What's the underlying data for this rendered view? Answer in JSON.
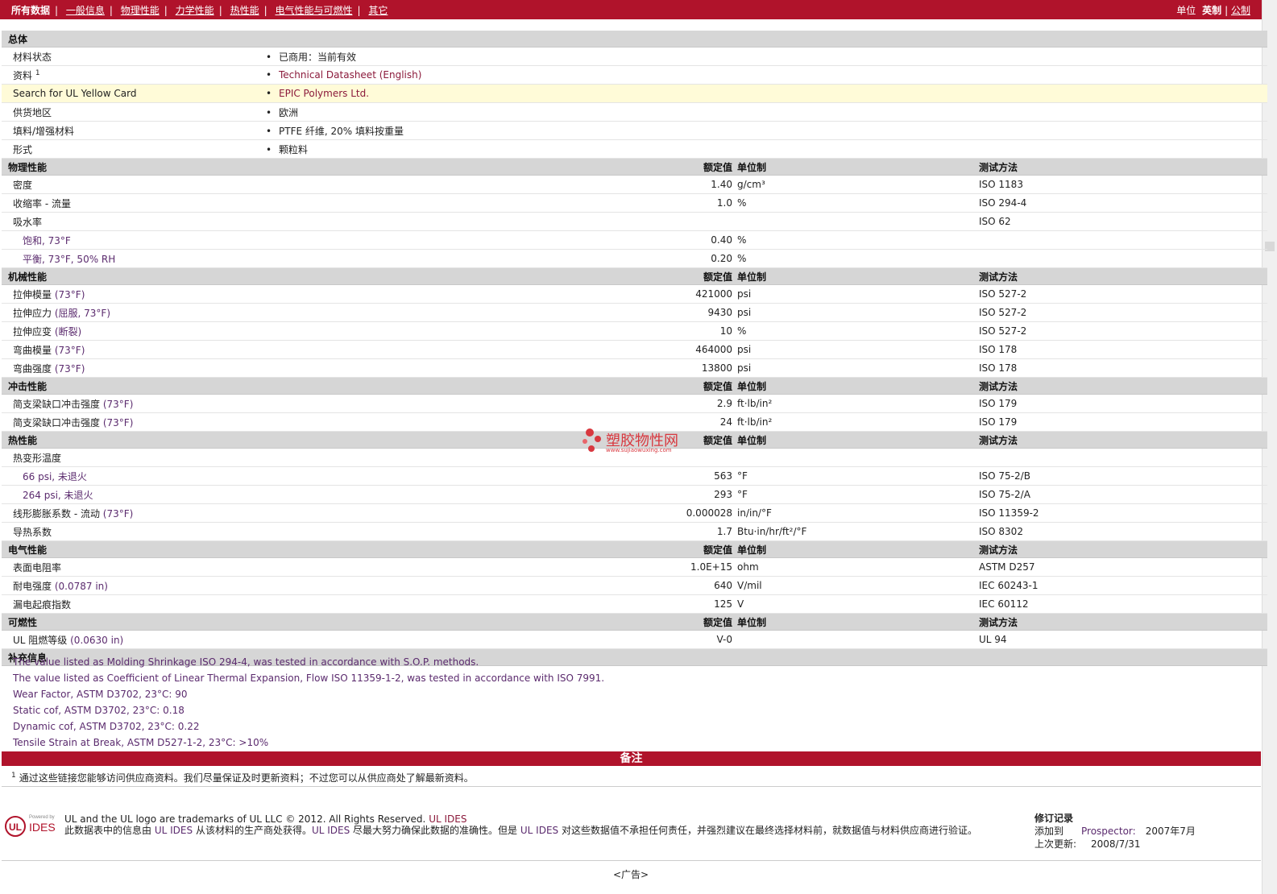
{
  "nav": {
    "all": "所有数据",
    "items": [
      "一般信息",
      "物理性能",
      "力学性能",
      "热性能",
      "电气性能与可燃性",
      "其它"
    ],
    "units_label": "单位",
    "units_active": "英制",
    "units_metric": "公制"
  },
  "general": {
    "title": "总体",
    "rows": [
      {
        "label": "材料状态",
        "value": "已商用：当前有效"
      },
      {
        "label": "资料",
        "sup": "1",
        "value": "Technical Datasheet (English)"
      },
      {
        "label": "Search for UL Yellow Card",
        "value": "EPIC Polymers Ltd."
      },
      {
        "label": "供货地区",
        "value": "欧洲"
      },
      {
        "label": "填料/增强材料",
        "value": "PTFE 纤维, 20% 填料按重量"
      },
      {
        "label": "形式",
        "value": "颗粒料"
      }
    ]
  },
  "col_headers": {
    "nominal": "额定值",
    "unit": "单位制",
    "method": "测试方法"
  },
  "physical": {
    "title": "物理性能",
    "rows": [
      {
        "label": "密度",
        "val": "1.40",
        "unit": "g/cm³",
        "method": "ISO 1183"
      },
      {
        "label": "收缩率 - 流量",
        "val": "1.0",
        "unit": "%",
        "method": "ISO 294-4"
      },
      {
        "label": "吸水率",
        "val": "",
        "unit": "",
        "method": "ISO 62"
      },
      {
        "label": "饱和, 73°F",
        "val": "0.40",
        "unit": "%",
        "method": ""
      },
      {
        "label": "平衡, 73°F, 50% RH",
        "val": "0.20",
        "unit": "%",
        "method": ""
      }
    ]
  },
  "mechanical": {
    "title": "机械性能",
    "rows": [
      {
        "label": "拉伸模量",
        "cond": "(73°F)",
        "val": "421000",
        "unit": "psi",
        "method": "ISO 527-2"
      },
      {
        "label": "拉伸应力",
        "cond": "(屈服, 73°F)",
        "val": "9430",
        "unit": "psi",
        "method": "ISO 527-2"
      },
      {
        "label": "拉伸应变",
        "cond": "(断裂)",
        "val": "10",
        "unit": "%",
        "method": "ISO 527-2"
      },
      {
        "label": "弯曲模量",
        "cond": "(73°F)",
        "val": "464000",
        "unit": "psi",
        "method": "ISO 178"
      },
      {
        "label": "弯曲强度",
        "cond": "(73°F)",
        "val": "13800",
        "unit": "psi",
        "method": "ISO 178"
      }
    ]
  },
  "impact": {
    "title": "冲击性能",
    "rows": [
      {
        "label": "简支梁缺口冲击强度",
        "cond": "(73°F)",
        "val": "2.9",
        "unit": "ft·lb/in²",
        "method": "ISO 179"
      },
      {
        "label": "简支梁缺口冲击强度",
        "cond": "(73°F)",
        "val": "24",
        "unit": "ft·lb/in²",
        "method": "ISO 179"
      }
    ]
  },
  "thermal": {
    "title": "热性能",
    "rows": [
      {
        "label": "热变形温度",
        "val": "",
        "unit": "",
        "method": ""
      },
      {
        "label": "66 psi, 未退火",
        "val": "563",
        "unit": "°F",
        "method": "ISO 75-2/B"
      },
      {
        "label": "264 psi, 未退火",
        "val": "293",
        "unit": "°F",
        "method": "ISO 75-2/A"
      },
      {
        "label": "线形膨胀系数 - 流动",
        "cond": "(73°F)",
        "val": "0.000028",
        "unit": "in/in/°F",
        "method": "ISO 11359-2"
      },
      {
        "label": "导热系数",
        "val": "1.7",
        "unit": "Btu·in/hr/ft²/°F",
        "method": "ISO 8302"
      }
    ]
  },
  "electrical": {
    "title": "电气性能",
    "rows": [
      {
        "label": "表面电阻率",
        "val": "1.0E+15",
        "unit": "ohm",
        "method": "ASTM D257"
      },
      {
        "label": "耐电强度",
        "cond": "(0.0787 in)",
        "val": "640",
        "unit": "V/mil",
        "method": "IEC 60243-1"
      },
      {
        "label": "漏电起痕指数",
        "val": "125",
        "unit": "V",
        "method": "IEC 60112"
      }
    ]
  },
  "flammability": {
    "title": "可燃性",
    "rows": [
      {
        "label": "UL 阻燃等级",
        "cond": "(0.0630 in)",
        "val": "V-0",
        "unit": "",
        "method": "UL 94"
      }
    ]
  },
  "supplementary": {
    "title": "补充信息",
    "lines": [
      "The value listed as Molding Shrinkage ISO 294-4, was tested in accordance with S.O.P. methods.",
      "The value listed as Coefficient of Linear Thermal Expansion, Flow ISO 11359-1-2, was tested in accordance with ISO 7991.",
      "Wear Factor, ASTM D3702, 23°C: 90",
      "Static cof, ASTM D3702, 23°C: 0.18",
      "Dynamic cof, ASTM D3702, 23°C: 0.22",
      "Tensile Strain at Break, ASTM D527-1-2, 23°C: >10%"
    ]
  },
  "remarks": {
    "title": "备注",
    "sup": "1",
    "text": "通过这些链接您能够访问供应商资料。我们尽量保证及时更新资料；不过您可以从供应商处了解最新资料。"
  },
  "footer": {
    "logo_small": "Powered by",
    "logo_ul": "UL",
    "logo_ides": "IDES",
    "line1": "UL and the UL logo are trademarks of UL LLC © 2012. All Rights Reserved.",
    "line1_link": "UL IDES",
    "line2a": "此数据表中的信息由",
    "line2_link1": "UL IDES",
    "line2b": "从该材料的生产商处获得。",
    "line2_link2": "UL IDES",
    "line2c": "尽最大努力确保此数据的准确性。但是",
    "line2_link3": "UL IDES",
    "line2d": "对这些数据值不承担任何责任，并强烈建议在最终选择材料前，就数据值与材料供应商进行验证。",
    "rev_title": "修订记录",
    "added_label": "添加到",
    "added_to": "Prospector:",
    "added_date": "2007年7月",
    "updated_label": "上次更新:",
    "updated_date": "2008/7/31",
    "ad": "<广告>"
  },
  "watermark": {
    "name": "塑胶物性网",
    "url": "www.sujiaowuxing.com"
  },
  "colors": {
    "brand_red": "#b0132b",
    "section_gray": "#d6d6d6",
    "highlight": "#fffbd8",
    "link": "#8b1a3b"
  }
}
